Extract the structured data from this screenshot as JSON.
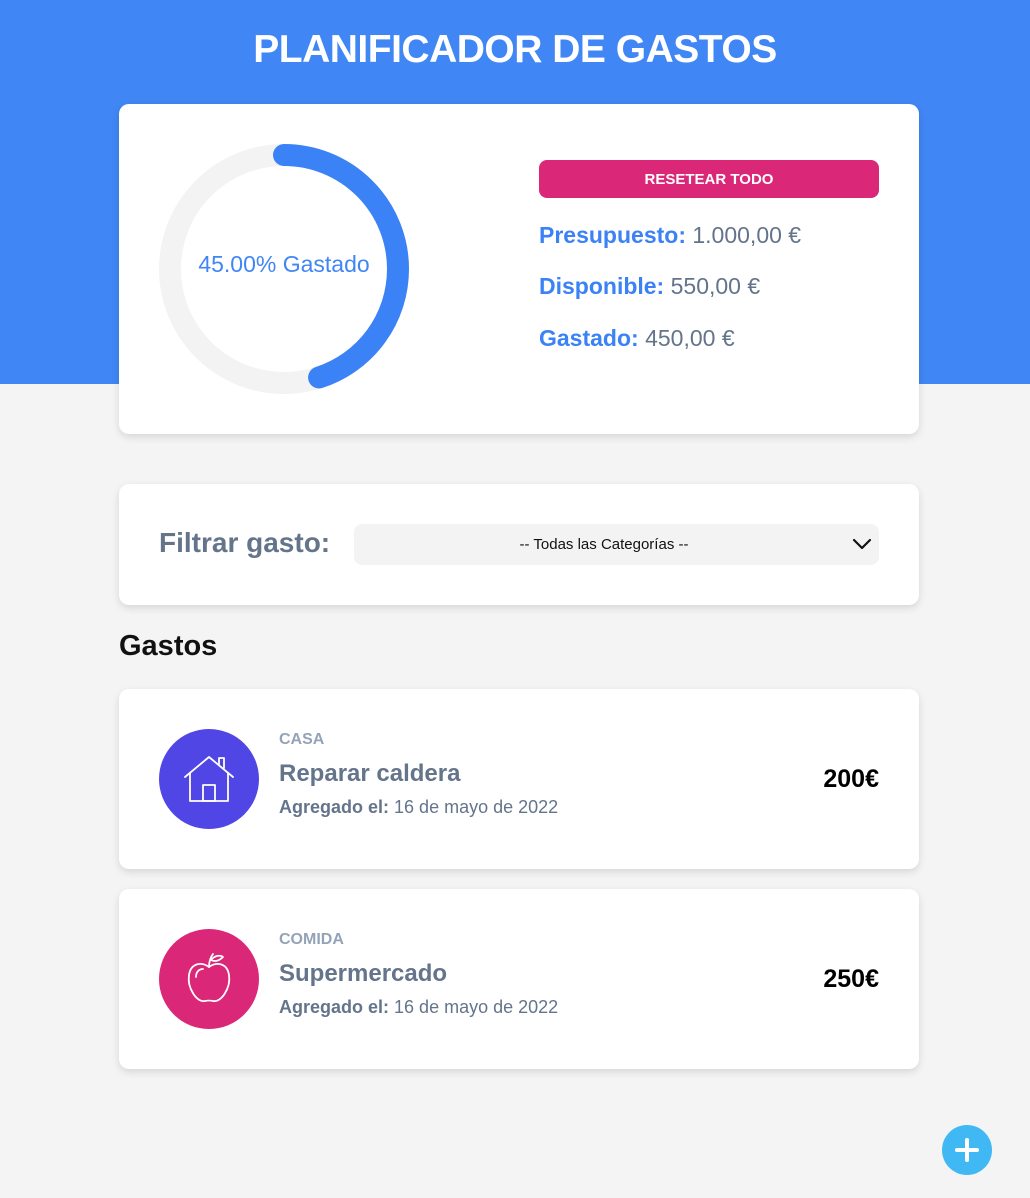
{
  "app": {
    "title": "PLANIFICADOR DE GASTOS"
  },
  "budget": {
    "percent_spent": 45.0,
    "progress_label": "45.00% Gastado",
    "reset_label": "RESETEAR TODO",
    "budget_label": "Presupuesto:",
    "budget_value": "1.000,00 €",
    "available_label": "Disponible:",
    "available_value": "550,00 €",
    "spent_label": "Gastado:",
    "spent_value": "450,00 €"
  },
  "filter": {
    "label": "Filtrar gasto:",
    "selected": "-- Todas las Categorías --"
  },
  "expenses_title": "Gastos",
  "expenses": [
    {
      "category": "CASA",
      "icon": "house-icon",
      "name": "Reparar caldera",
      "date_label": "Agregado el:",
      "date": "16 de mayo de 2022",
      "amount": "200€"
    },
    {
      "category": "COMIDA",
      "icon": "apple-icon",
      "name": "Supermercado",
      "date_label": "Agregado el:",
      "date": "16 de mayo de 2022",
      "amount": "250€"
    }
  ],
  "colors": {
    "primary": "#4086f4",
    "accent": "#db2777",
    "casa": "#4f46e5",
    "comida": "#db2777",
    "add_button": "#3fb8f3"
  }
}
